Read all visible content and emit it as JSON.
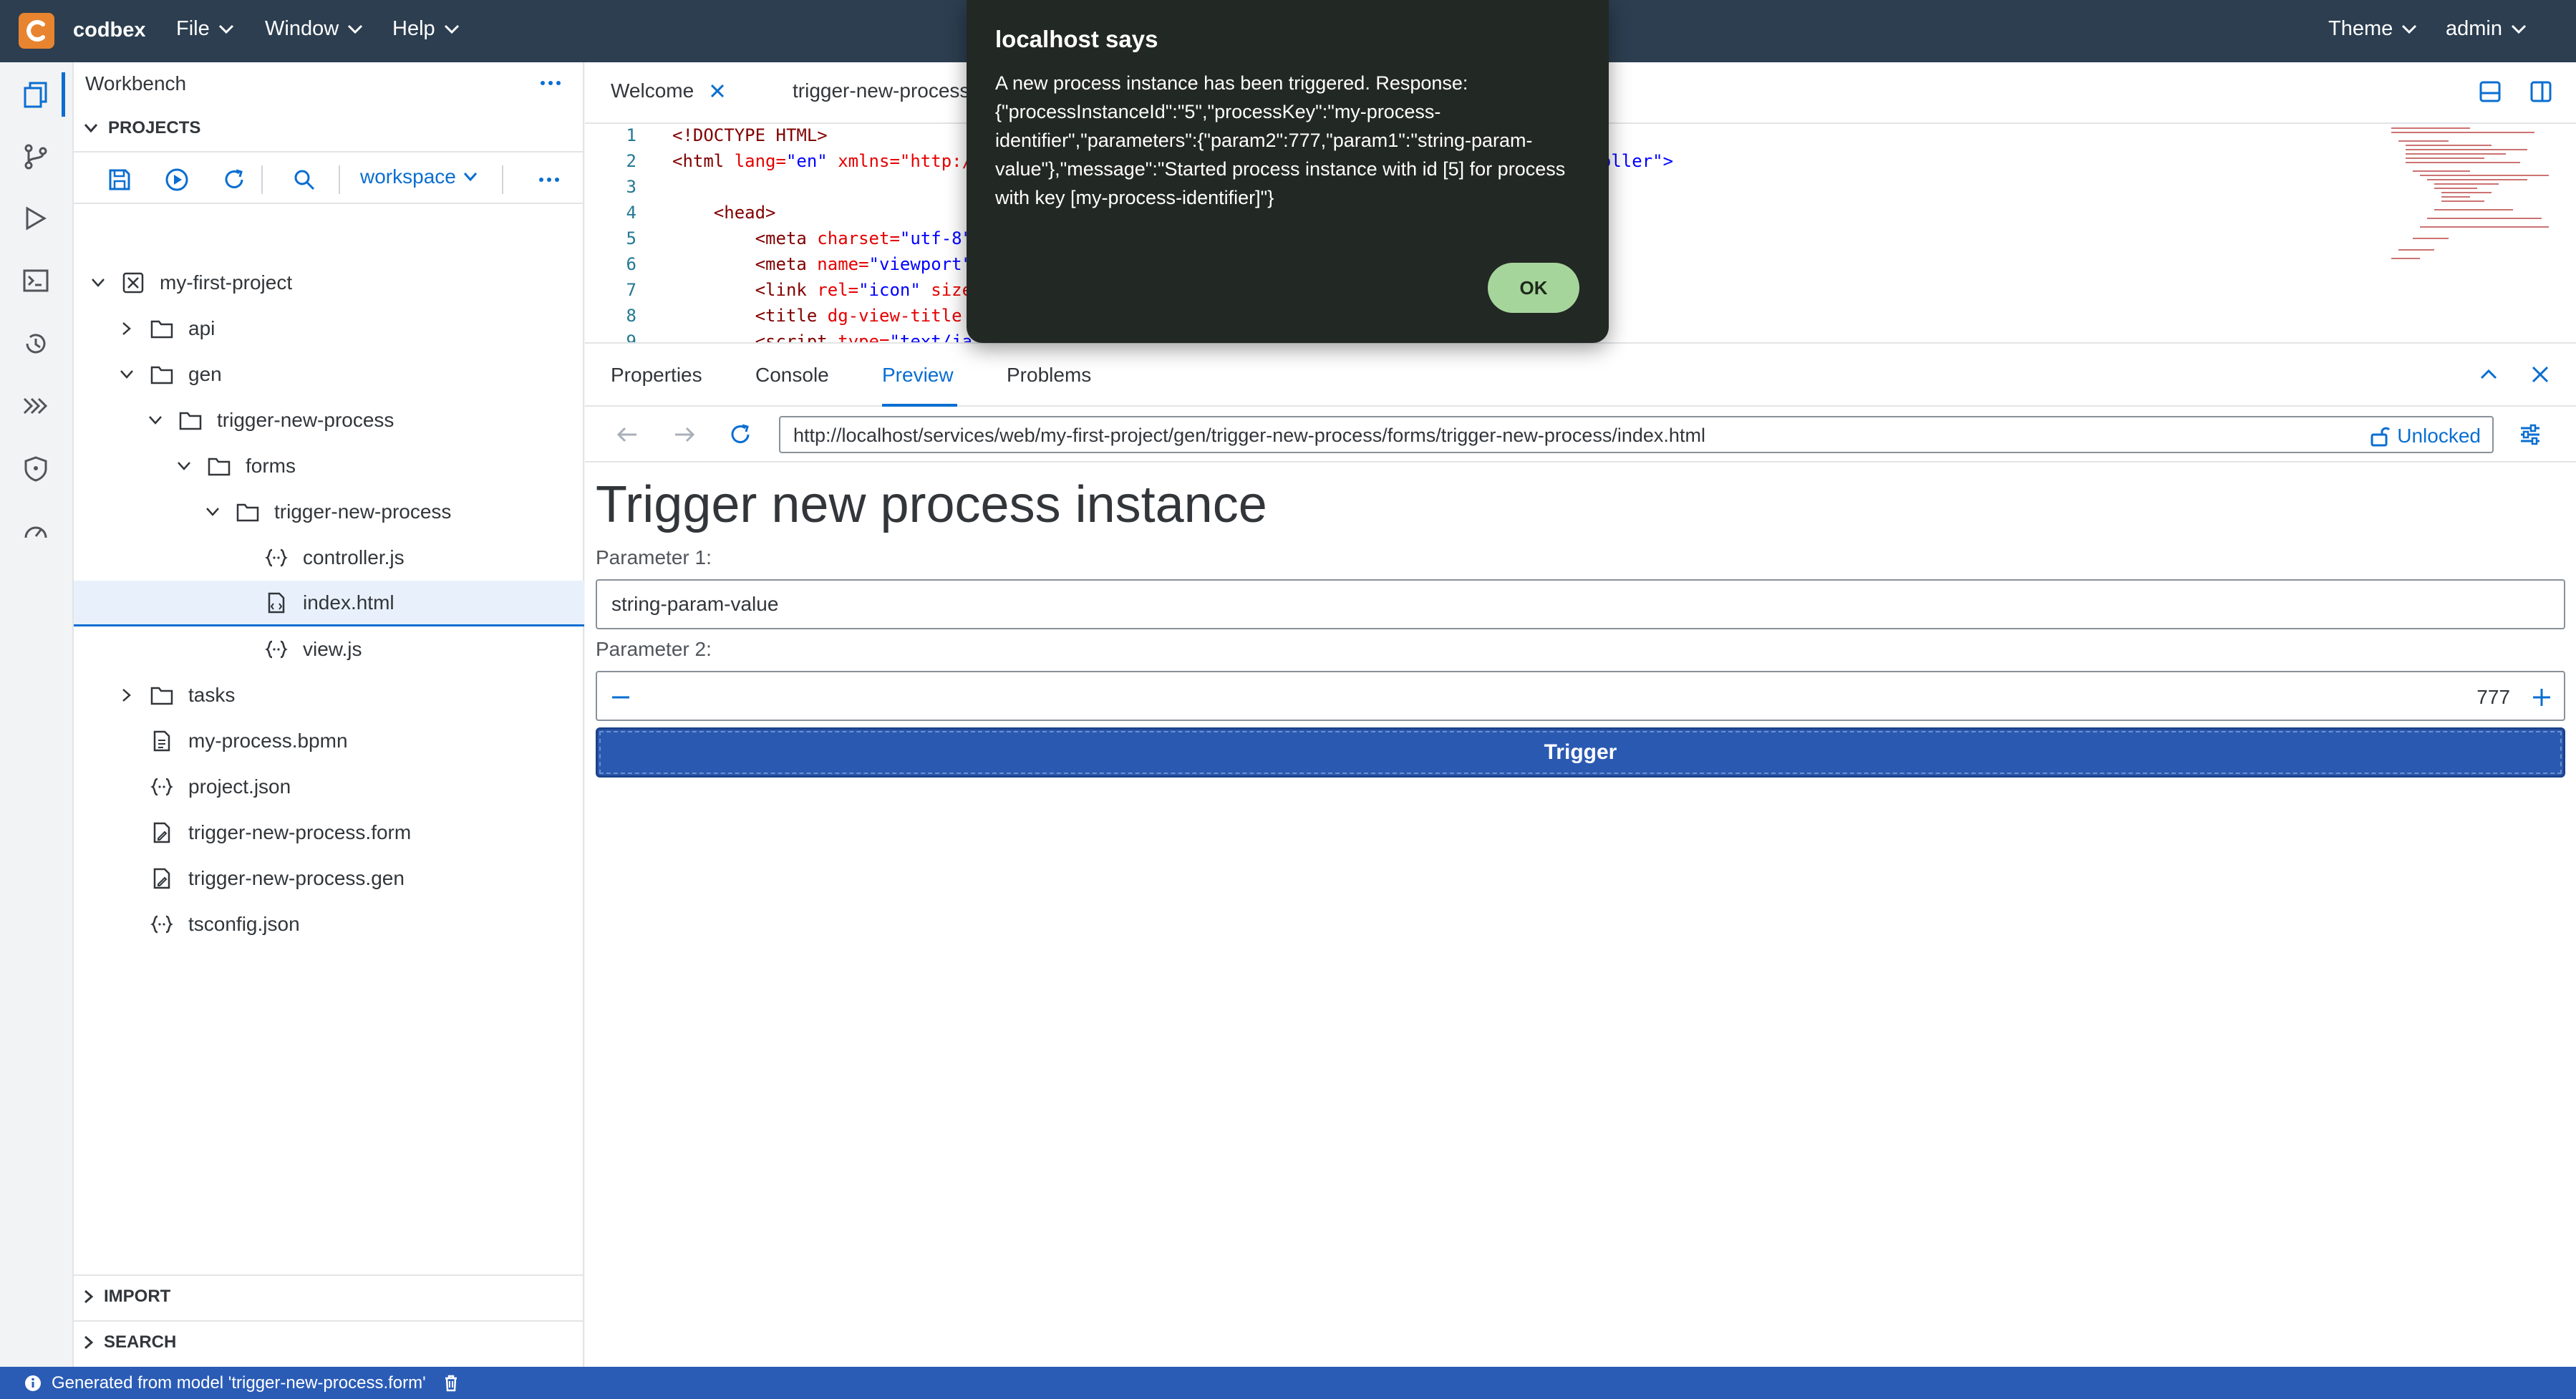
{
  "app": {
    "brand": "codbex"
  },
  "menu": {
    "file": "File",
    "window": "Window",
    "help": "Help",
    "theme": "Theme",
    "user": "admin"
  },
  "sidebar": {
    "title": "Workbench",
    "projects_header": "PROJECTS",
    "workspace": "workspace",
    "import_header": "IMPORT",
    "search_header": "SEARCH",
    "tree": [
      {
        "label": "my-first-project"
      },
      {
        "label": "api"
      },
      {
        "label": "gen"
      },
      {
        "label": "trigger-new-process"
      },
      {
        "label": "forms"
      },
      {
        "label": "trigger-new-process"
      },
      {
        "label": "controller.js"
      },
      {
        "label": "index.html"
      },
      {
        "label": "view.js"
      },
      {
        "label": "tasks"
      },
      {
        "label": "my-process.bpmn"
      },
      {
        "label": "project.json"
      },
      {
        "label": "trigger-new-process.form"
      },
      {
        "label": "trigger-new-process.gen"
      },
      {
        "label": "tsconfig.json"
      }
    ]
  },
  "editor": {
    "tabs": [
      {
        "label": "Welcome"
      },
      {
        "label": "trigger-new-process"
      }
    ],
    "lines": [
      {
        "n": "1",
        "a": "<!DOCTYPE HTML>",
        "b": "",
        "c": "",
        "d": ""
      },
      {
        "n": "2",
        "a": "<html ",
        "b": "lang=",
        "c": "\"en\" ",
        "d": "xmlns=\"http:/"
      },
      {
        "n": "3",
        "a": "",
        "b": "",
        "c": "",
        "d": ""
      },
      {
        "n": "4",
        "a": "    <head>",
        "b": "",
        "c": "",
        "d": ""
      },
      {
        "n": "5",
        "a": "        <meta ",
        "b": "charset=",
        "c": "\"utf-8\"",
        "d": ""
      },
      {
        "n": "6",
        "a": "        <meta ",
        "b": "name=",
        "c": "\"viewport\"",
        "d": ""
      },
      {
        "n": "7",
        "a": "        <link ",
        "b": "rel=",
        "c": "\"icon\" ",
        "d": "size"
      },
      {
        "n": "8",
        "a": "        <title ",
        "b": "dg-view-title",
        "c": "",
        "d": ""
      },
      {
        "n": "9",
        "a": "        <script ",
        "b": "type=",
        "c": "\"text/ja",
        "d": ""
      }
    ],
    "line2_tail": "troller\">"
  },
  "panel": {
    "tabs": {
      "properties": "Properties",
      "console": "Console",
      "preview": "Preview",
      "problems": "Problems"
    },
    "url": "http://localhost/services/web/my-first-project/gen/trigger-new-process/forms/trigger-new-process/index.html",
    "lock_label": "Unlocked"
  },
  "form": {
    "title": "Trigger new process instance",
    "param1_label": "Parameter 1:",
    "param1_value": "string-param-value",
    "param2_label": "Parameter 2:",
    "param2_value": "777",
    "trigger_label": "Trigger"
  },
  "status": {
    "message": "Generated from model 'trigger-new-process.form'"
  },
  "dialog": {
    "title": "localhost says",
    "message": "A new process instance has been triggered. Response: {\"processInstanceId\":\"5\",\"processKey\":\"my-process-identifier\",\"parameters\":{\"param2\":777,\"param1\":\"string-param-value\"},\"message\":\"Started process instance with id [5] for process with key [my-process-identifier]\"}",
    "ok_label": "OK"
  },
  "colors": {
    "topbar": "#2c3e50",
    "accent": "#0a6ed1",
    "brand": "#e8842f",
    "status": "#2a5cb6",
    "trigger": "#2a59b1"
  }
}
